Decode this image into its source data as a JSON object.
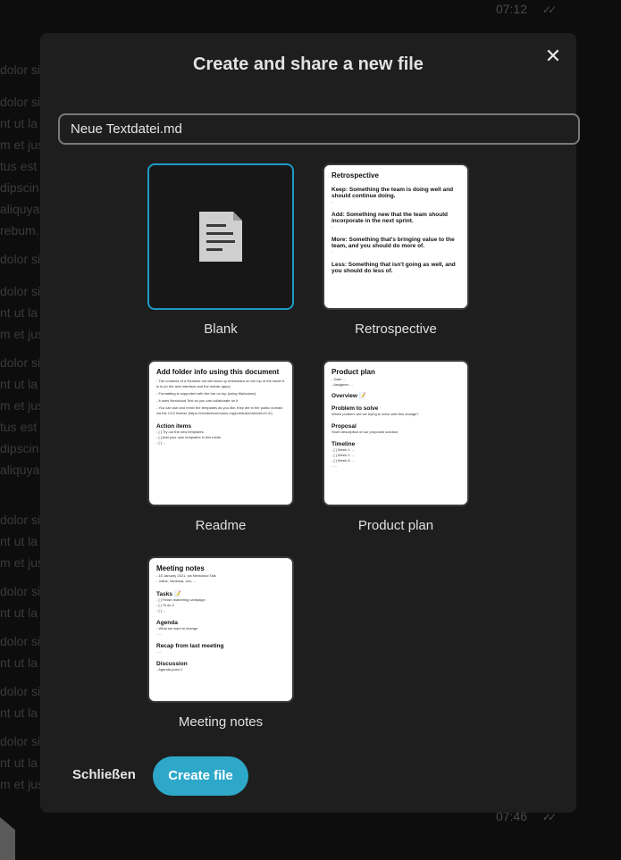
{
  "background": {
    "time_top": "07:12",
    "time_bottom": "07:46",
    "lines": [
      "dolor si",
      "dolor si",
      "nt ut la",
      "m et jus",
      "tus est",
      "dipscin",
      "aliquya",
      "rebum.",
      "dolor si",
      "dolor si",
      "nt ut la",
      "m et jus",
      "dolor si",
      "nt ut la",
      "m et jus",
      "tus est",
      "dipscin",
      "aliquya",
      "dolor si",
      "nt ut la",
      "m et jus",
      "dolor si",
      "nt ut la",
      "dolor si",
      "nt ut la",
      "dolor si",
      "nt ut la",
      "dolor si",
      "nt ut la",
      "m et jus"
    ]
  },
  "modal": {
    "title": "Create and share a new file",
    "close_icon": "close-icon",
    "filename_value": "Neue Textdatei.md",
    "templates": [
      {
        "label": "Blank"
      },
      {
        "label": "Retrospective"
      },
      {
        "label": "Readme"
      },
      {
        "label": "Product plan"
      },
      {
        "label": "Meeting notes"
      }
    ],
    "previews": {
      "retrospective": {
        "title": "Retrospective",
        "keep": "Keep: Something the team is doing well and should continue doing.",
        "add": "Add: Something new that the team should incorporate in the next sprint.",
        "more": "More: Something that's bringing value to the team, and you should do more of.",
        "less": "Less: Something that isn't going as well, and you should do less of."
      },
      "readme": {
        "title": "Add folder info using this document",
        "line1": "- The contents of a Readme.md will show up embedded on the top of the folder it is in (in the web interface and the mobile apps)",
        "line2": "- Formatting is supported with the bar on top (using Markdown)",
        "line3": "- It uses Nextcloud Text so you can collaborate on it",
        "line4": "- You can use and remix the templates as you like, they are in the public domain via the CC0 license (https://creativecommons.org/publicdomain/zero/1.0/)",
        "section": "Action items",
        "item1": "- [ ] Try out the new templates",
        "item2": "- [ ] Add your own templates in this folder",
        "item3": "- [ ] ..."
      },
      "product_plan": {
        "title": "Product plan",
        "date": "- Date: ...",
        "assignee": "- Assignee: ...",
        "overview": "Overview 📝",
        "problem": "Problem to solve",
        "problem_text": "Which problem are we trying to solve with this change?",
        "proposal": "Proposal",
        "proposal_text": "Short description of our proposed solution.",
        "timeline": "Timeline",
        "w1": "- [ ] Week 1: ...",
        "w2": "- [ ] Week 2: ...",
        "w3": "- [ ] Week 3: ...",
        "w4": "- ..."
      },
      "meeting_notes": {
        "title": "Meeting notes",
        "date": "- 15 January 2021, via Nextcloud Talk",
        "people": "- Julius, Vanessa, Jan, ...",
        "tasks": "Tasks 📝",
        "t1": "- [ ] Finish marketing campaign",
        "t2": "- [ ] To do 2",
        "t3": "- [ ] ...",
        "agenda": "Agenda",
        "a1": "- What we want to change",
        "a2": "- ...",
        "recap": "Recap from last meeting",
        "r1": "- ...",
        "discussion": "Discussion",
        "d1": "- Agenda point 1"
      }
    },
    "close_button": "Schließen",
    "create_button": "Create file"
  }
}
